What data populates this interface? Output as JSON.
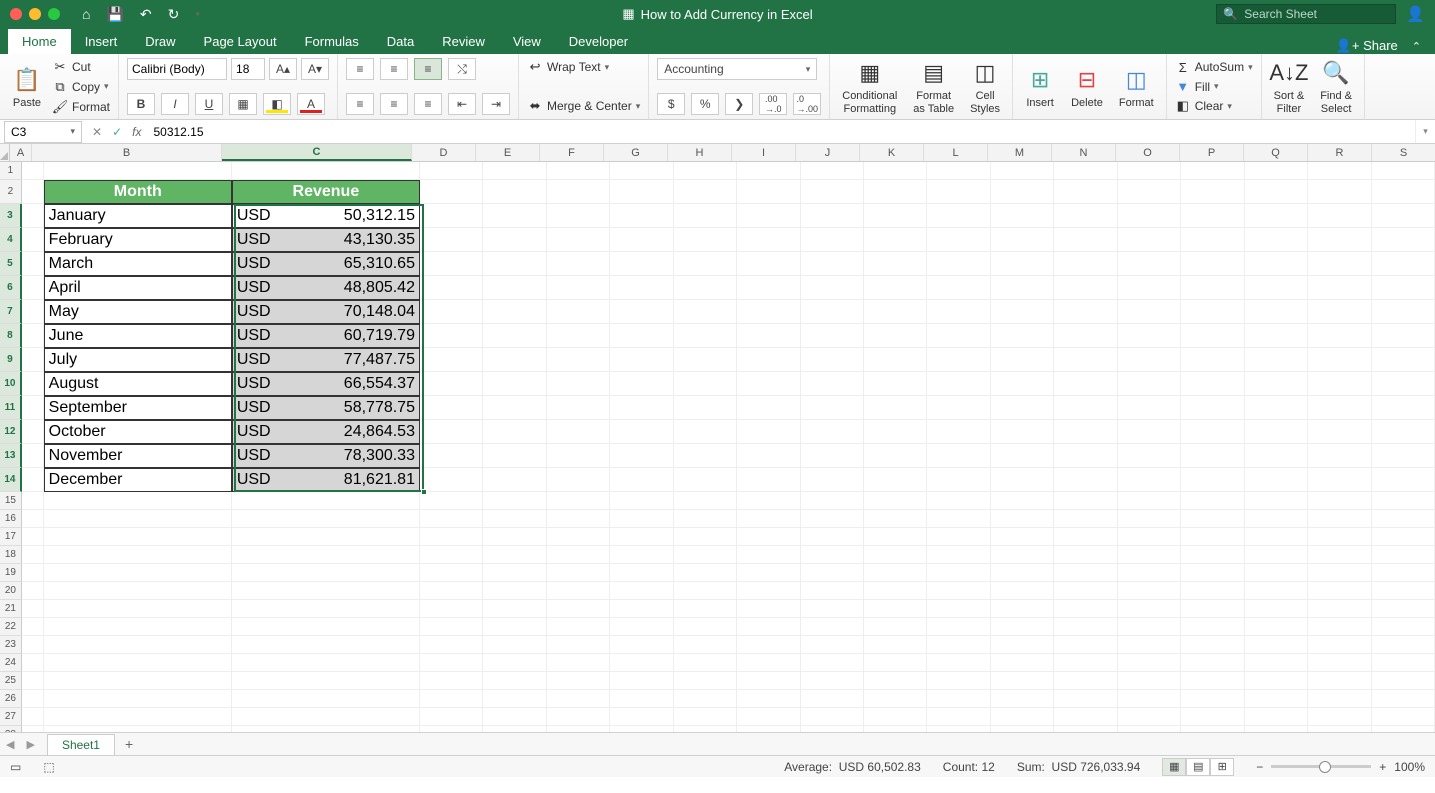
{
  "title": "How to Add Currency in Excel",
  "search_placeholder": "Search Sheet",
  "share_label": "Share",
  "tabs": [
    "Home",
    "Insert",
    "Draw",
    "Page Layout",
    "Formulas",
    "Data",
    "Review",
    "View",
    "Developer"
  ],
  "active_tab": "Home",
  "clipboard": {
    "paste": "Paste",
    "cut": "Cut",
    "copy": "Copy",
    "format": "Format"
  },
  "font": {
    "name": "Calibri (Body)",
    "size": "18"
  },
  "wrap": "Wrap Text",
  "merge": "Merge & Center",
  "number_format": "Accounting",
  "cond": "Conditional\nFormatting",
  "fmttab": "Format\nas Table",
  "cellstyles": "Cell\nStyles",
  "insert": "Insert",
  "delete": "Delete",
  "format_btn": "Format",
  "autosum": "AutoSum",
  "fill": "Fill",
  "clear": "Clear",
  "sort": "Sort &\nFilter",
  "find": "Find &\nSelect",
  "namebox": "C3",
  "formula_value": "50312.15",
  "cols": [
    "A",
    "B",
    "C",
    "D",
    "E",
    "F",
    "G",
    "H",
    "I",
    "J",
    "K",
    "L",
    "M",
    "N",
    "O",
    "P",
    "Q",
    "R",
    "S"
  ],
  "table": {
    "headers": [
      "Month",
      "Revenue"
    ],
    "rows": [
      {
        "month": "January",
        "cur": "USD",
        "val": "50,312.15"
      },
      {
        "month": "February",
        "cur": "USD",
        "val": "43,130.35"
      },
      {
        "month": "March",
        "cur": "USD",
        "val": "65,310.65"
      },
      {
        "month": "April",
        "cur": "USD",
        "val": "48,805.42"
      },
      {
        "month": "May",
        "cur": "USD",
        "val": "70,148.04"
      },
      {
        "month": "June",
        "cur": "USD",
        "val": "60,719.79"
      },
      {
        "month": "July",
        "cur": "USD",
        "val": "77,487.75"
      },
      {
        "month": "August",
        "cur": "USD",
        "val": "66,554.37"
      },
      {
        "month": "September",
        "cur": "USD",
        "val": "58,778.75"
      },
      {
        "month": "October",
        "cur": "USD",
        "val": "24,864.53"
      },
      {
        "month": "November",
        "cur": "USD",
        "val": "78,300.33"
      },
      {
        "month": "December",
        "cur": "USD",
        "val": "81,621.81"
      }
    ]
  },
  "sheet_tab": "Sheet1",
  "status": {
    "avg_label": "Average:",
    "avg": "USD 60,502.83",
    "count_label": "Count:",
    "count": "12",
    "sum_label": "Sum:",
    "sum": "USD 726,033.94",
    "zoom": "100%"
  }
}
